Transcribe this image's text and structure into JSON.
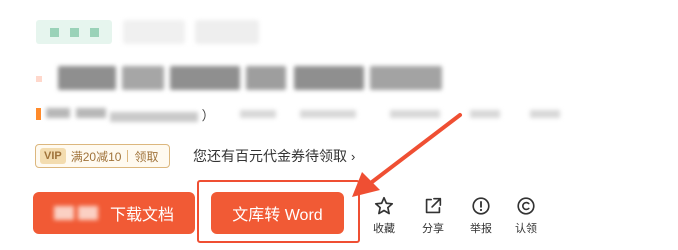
{
  "subtitle": {
    "text": "）"
  },
  "coupon": {
    "badge": "VIP",
    "desc": "满20减10",
    "claim": "领取"
  },
  "voucher": {
    "text": "您还有百元代金券待领取",
    "chevron": "›"
  },
  "buttons": {
    "download_label": "下载文档",
    "word_label": "文库转 Word"
  },
  "actions": [
    {
      "label": "收藏",
      "icon": "star-icon"
    },
    {
      "label": "分享",
      "icon": "share-icon"
    },
    {
      "label": "举报",
      "icon": "report-icon"
    },
    {
      "label": "认领",
      "icon": "copyright-icon"
    }
  ],
  "colors": {
    "primary": "#f15a35",
    "annotation": "#ef4f33",
    "vip_gold": "#a0733a",
    "tag_green": "#e6f5ee"
  }
}
